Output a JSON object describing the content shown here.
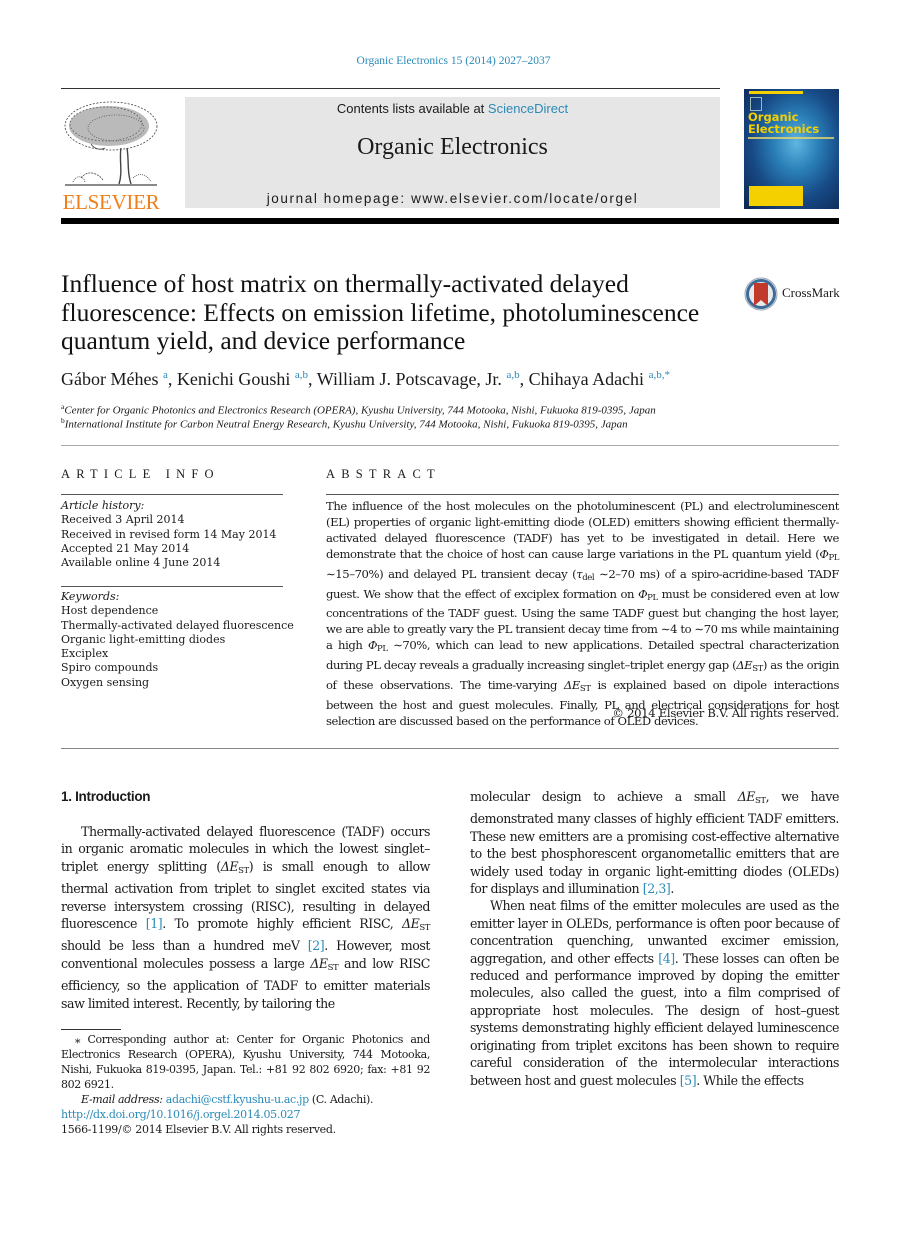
{
  "header": {
    "journal_ref": "Organic Electronics 15 (2014) 2027–2037",
    "contents_prefix": "Contents lists available at ",
    "contents_link": "ScienceDirect",
    "journal_name": "Organic Electronics",
    "homepage": "journal homepage: www.elsevier.com/locate/orgel",
    "publisher": "ELSEVIER",
    "cover_title_1": "Organic",
    "cover_title_2": "Electronics"
  },
  "article": {
    "title": "Influence of host matrix on thermally-activated delayed fluorescence: Effects on emission lifetime, photoluminescence quantum yield, and device performance",
    "crossmark_label": "CrossMark",
    "authors": [
      {
        "name": "Gábor Méhes",
        "aff": "a"
      },
      {
        "name": "Kenichi Goushi",
        "aff": "a,b"
      },
      {
        "name": "William J. Potscavage, Jr.",
        "aff": "a,b"
      },
      {
        "name": "Chihaya Adachi",
        "aff": "a,b,*"
      }
    ],
    "affiliations": [
      {
        "mark": "a",
        "text": "Center for Organic Photonics and Electronics Research (OPERA), Kyushu University, 744 Motooka, Nishi, Fukuoka 819-0395, Japan"
      },
      {
        "mark": "b",
        "text": "International Institute for Carbon Neutral Energy Research, Kyushu University, 744 Motooka, Nishi, Fukuoka 819-0395, Japan"
      }
    ]
  },
  "article_info": {
    "heading": "ARTICLE INFO",
    "history_label": "Article history:",
    "history": [
      "Received 3 April 2014",
      "Received in revised form 14 May 2014",
      "Accepted 21 May 2014",
      "Available online 4 June 2014"
    ],
    "keywords_label": "Keywords:",
    "keywords": [
      "Host dependence",
      "Thermally-activated delayed fluorescence",
      "Organic light-emitting diodes",
      "Exciplex",
      "Spiro compounds",
      "Oxygen sensing"
    ]
  },
  "abstract": {
    "heading": "ABSTRACT",
    "p1": "The influence of the host molecules on the photoluminescent (PL) and electroluminescent (EL) properties of organic light-emitting diode (OLED) emitters showing efficient thermally-activated delayed fluorescence (TADF) has yet to be investigated in detail. Here we demonstrate that the choice of host can cause large variations in the PL quantum yield (",
    "phi": "Φ",
    "pl": "PL",
    "p2": " ∼15–70%) and delayed PL transient decay (",
    "tau": "τ",
    "del": "del",
    "p3": " ∼2–70 ms) of a spiro-acridine-based TADF guest. We show that the effect of exciplex formation on ",
    "p4": " must be considered even at low concentrations of the TADF guest. Using the same TADF guest but changing the host layer, we are able to greatly vary the PL transient decay time from ∼4 to ∼70 ms while maintaining a high ",
    "p5": " ∼70%, which can lead to new applications. Detailed spectral characterization during PL decay reveals a gradually increasing singlet–triplet energy gap (",
    "delta_e": "ΔE",
    "st": "ST",
    "p6": ") as the origin of these observations. The time-varying ",
    "p7": " is explained based on dipole interactions between the host and guest molecules. Finally, PL and electrical considerations for host selection are discussed based on the performance of OLED devices.",
    "copyright": "© 2014 Elsevier B.V. All rights reserved."
  },
  "body": {
    "section_heading": "1. Introduction",
    "left": {
      "a": "Thermally-activated delayed fluorescence (TADF) occurs in organic aromatic molecules in which the lowest singlet–triplet energy splitting (",
      "b": ") is small enough to allow thermal activation from triplet to singlet excited states via reverse intersystem crossing (RISC), resulting in delayed fluorescence ",
      "ref1": "[1]",
      "c": ". To promote highly efficient RISC, ",
      "d": " should be less than a hundred meV ",
      "ref2": "[2]",
      "e": ". However, most conventional molecules possess a large ",
      "f": " and low RISC efficiency, so the application of TADF to emitter materials saw limited interest. Recently, by tailoring the"
    },
    "right": {
      "a": "molecular design to achieve a small ",
      "b": ", we have demonstrated many classes of highly efficient TADF emitters. These new emitters are a promising cost-effective alternative to the best phosphorescent organometallic emitters that are widely used today in organic light-emitting diodes (OLEDs) for displays and illumination ",
      "ref23": "[2,3]",
      "c": ".",
      "d": "When neat films of the emitter molecules are used as the emitter layer in OLEDs, performance is often poor because of concentration quenching, unwanted excimer emission, aggregation, and other effects ",
      "ref4": "[4]",
      "e": ". These losses can often be reduced and performance improved by doping the emitter molecules, also called the guest, into a film comprised of appropriate host molecules. The design of host–guest systems demonstrating highly efficient delayed luminescence originating from triplet excitons has been shown to require careful consideration of the intermolecular interactions between host and guest molecules ",
      "ref5": "[5]",
      "f": ". While the effects"
    }
  },
  "footnote": {
    "star": "⁎",
    "corresponding": " Corresponding author at: Center for Organic Photonics and Electronics Research (OPERA), Kyushu University, 744 Motooka, Nishi, Fukuoka 819-0395, Japan. Tel.: +81 92 802 6920; fax: +81 92 802 6921.",
    "email_label": "E-mail address:",
    "email": "adachi@cstf.kyushu-u.ac.jp",
    "email_suffix": " (C. Adachi).",
    "doi": "http://dx.doi.org/10.1016/j.orgel.2014.05.027",
    "issn": "1566-1199/© 2014 Elsevier B.V. All rights reserved."
  },
  "colors": {
    "link": "#2a8ab8",
    "elsevier_orange": "#f07f1a",
    "masthead_bg": "#e6e6e6",
    "cover_yellow": "#f5d000"
  }
}
